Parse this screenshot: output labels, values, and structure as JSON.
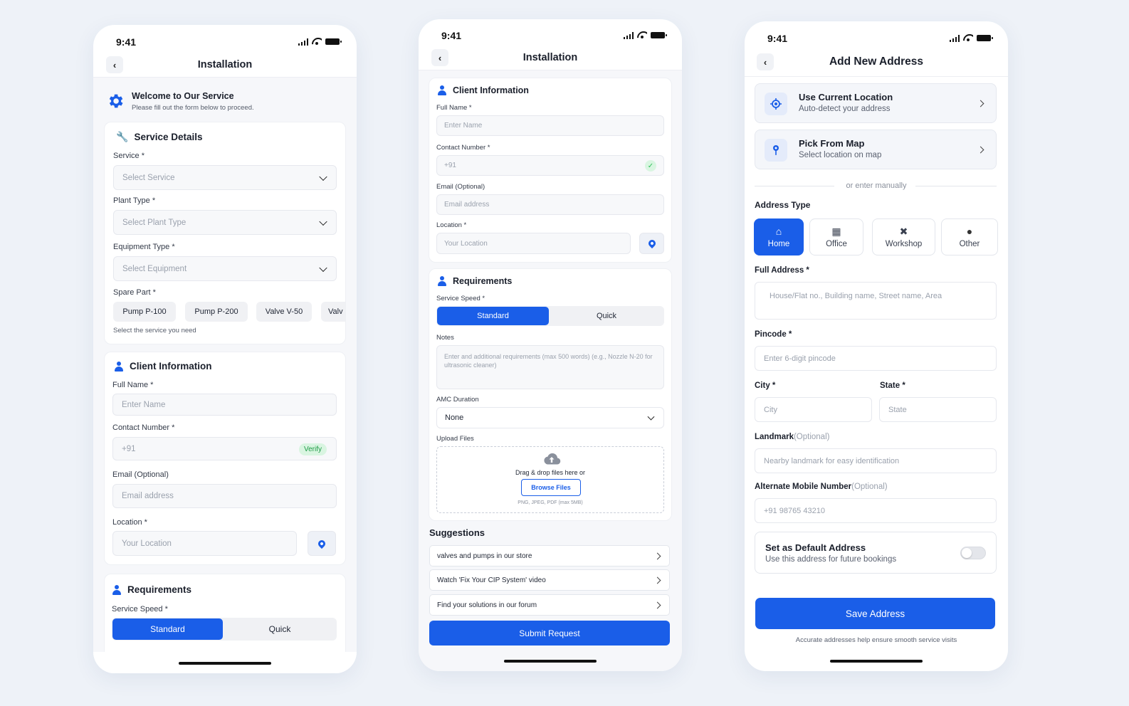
{
  "status": {
    "time": "9:41"
  },
  "phone1": {
    "title": "Installation",
    "welcome": {
      "title": "Welcome to Our Service",
      "subtitle": "Please fill out the form below to proceed."
    },
    "service_details": {
      "heading": "Service Details",
      "service_label": "Service *",
      "service_placeholder": "Select Service",
      "plant_label": "Plant Type *",
      "plant_placeholder": "Select Plant Type",
      "equipment_label": "Equipment Type *",
      "equipment_placeholder": "Select Equipment",
      "spare_label": "Spare Part *",
      "spare_parts": [
        "Pump P-100",
        "Pump P-200",
        "Valve V-50",
        "Valv"
      ],
      "helper": "Select the service you need"
    },
    "client": {
      "heading": "Client Information",
      "name_label": "Full Name *",
      "name_placeholder": "Enter Name",
      "contact_label": "Contact Number *",
      "contact_placeholder": "+91",
      "verify": "Verify",
      "email_label": "Email (Optional)",
      "email_placeholder": "Email address",
      "location_label": "Location *",
      "location_placeholder": "Your Location"
    },
    "requirements": {
      "heading": "Requirements",
      "speed_label": "Service Speed *",
      "standard": "Standard",
      "quick": "Quick"
    }
  },
  "phone2": {
    "title": "Installation",
    "client": {
      "heading": "Client Information",
      "name_label": "Full Name *",
      "name_placeholder": "Enter Name",
      "contact_label": "Contact Number *",
      "contact_placeholder": "+91",
      "email_label": "Email (Optional)",
      "email_placeholder": "Email address",
      "location_label": "Location *",
      "location_placeholder": "Your Location"
    },
    "requirements": {
      "heading": "Requirements",
      "speed_label": "Service Speed *",
      "standard": "Standard",
      "quick": "Quick",
      "notes_label": "Notes",
      "notes_placeholder": "Enter and additional requirements (max 500 words) (e.g., Nozzle N-20 for ultrasonic cleaner)",
      "amc_label": "AMC Duration",
      "amc_value": "None",
      "upload_label": "Upload Files",
      "upload_text": "Drag & drop files here or",
      "browse": "Browse Files",
      "upload_hint": "PNG, JPEG, PDF (max 5MB)"
    },
    "suggestions": {
      "heading": "Suggestions",
      "items": [
        "valves and pumps in our store",
        "Watch 'Fix Your CIP System' video",
        "Find your solutions in our forum"
      ]
    },
    "submit": "Submit Request"
  },
  "phone3": {
    "title": "Add New Address",
    "current": {
      "title": "Use Current Location",
      "subtitle": "Auto-detect your address"
    },
    "map": {
      "title": "Pick From Map",
      "subtitle": "Select location on map"
    },
    "divider": "or enter manually",
    "type_label": "Address Type",
    "types": [
      "Home",
      "Office",
      "Workshop",
      "Other"
    ],
    "full_label": "Full Address *",
    "full_placeholder": "House/Flat no., Building name, Street name, Area",
    "pincode_label": "Pincode *",
    "pincode_placeholder": "Enter 6-digit pincode",
    "city_label": "City *",
    "city_placeholder": "City",
    "state_label": "State *",
    "state_placeholder": "State",
    "landmark_label": "Landmark",
    "landmark_opt": "(Optional)",
    "landmark_placeholder": "Nearby landmark for easy identification",
    "alt_label": "Alternate Mobile Number",
    "alt_opt": "(Optional)",
    "alt_placeholder": "+91 98765 43210",
    "default": {
      "title": "Set as Default Address",
      "subtitle": "Use this address for future bookings"
    },
    "save": "Save Address",
    "footer": "Accurate addresses help ensure smooth service visits"
  },
  "colors": {
    "accent": "#1a5ee8",
    "success": "#2fbf5b"
  }
}
